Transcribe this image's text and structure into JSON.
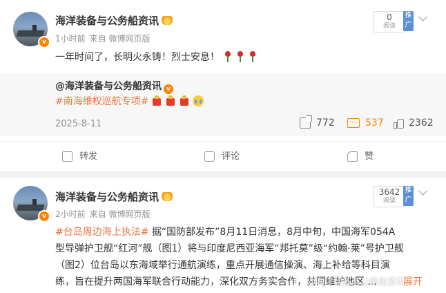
{
  "posts": [
    {
      "author": "海洋装备与公务船资讯",
      "time": "1小时前",
      "source": "来自 微博网页版",
      "read_count": "0",
      "read_label": "阅读",
      "promote_label": "推广",
      "text": "一年时间了，长明火永铸！烈士安息！",
      "text_emoji_icons": [
        "rose-icon",
        "rose-icon",
        "rose-icon"
      ],
      "repost": {
        "author": "@海洋装备与公务船资讯",
        "hashtag": "#南海维权巡航专项#",
        "emoji_icons": [
          "red-envelope-icon",
          "red-envelope-icon",
          "red-envelope-icon",
          "crying-face-icon"
        ],
        "date": "2025-8-11",
        "shares": "772",
        "comments": "537",
        "likes": "2362"
      },
      "actions": {
        "forward": "转发",
        "comment": "评论",
        "like": "赞"
      }
    },
    {
      "author": "海洋装备与公务船资讯",
      "time": "2小时前",
      "source": "来自 微博网页版",
      "read_count": "3642",
      "read_label": "阅读",
      "promote_label": "推广",
      "hashtag": "#台岛周边海上执法#",
      "lines": [
        " 据“国防部发布”8月11日消息，8月中旬，中国海军054A",
        "型导弹护卫舰“红河”舰（图1）将与印度尼西亚海军“邦托莫”级“约翰·莱”号护卫舰",
        "（图2）位台岛以东海域举行通航演练，重点开展通信操演、海上补给等科目演",
        "练，旨在提升两国海军联合行动能力，深化双方务实合作，共同维护地区 ..."
      ],
      "watermark": "@海洋装备与公务船资讯",
      "expand_label": "展开"
    }
  ],
  "colors": {
    "accent": "#ff8200",
    "hashtag": "#eb7340",
    "promote": "#5b8fd6"
  }
}
